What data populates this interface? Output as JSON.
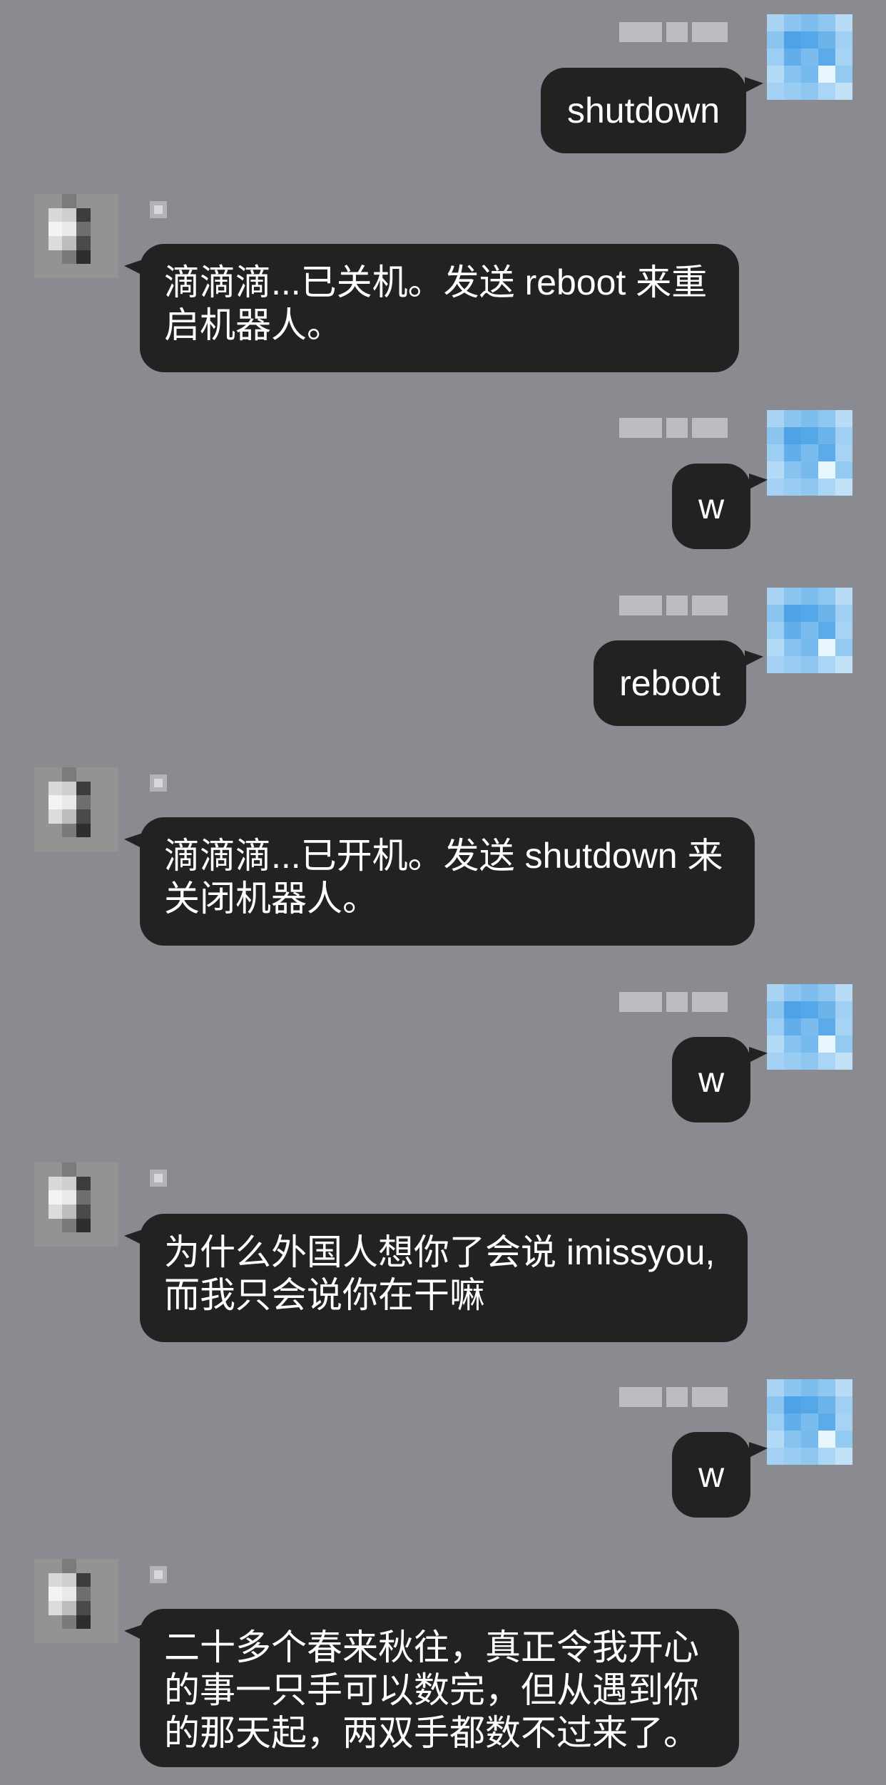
{
  "colors": {
    "background": "#8a8b90",
    "bubble": "#222222",
    "text": "#ffffff"
  },
  "messages": [
    {
      "from": "me",
      "text": "shutdown"
    },
    {
      "from": "bot",
      "text": "滴滴滴...已关机。发送 reboot 来重\n启机器人。"
    },
    {
      "from": "me",
      "text": "w"
    },
    {
      "from": "me",
      "text": "reboot"
    },
    {
      "from": "bot",
      "text": "滴滴滴...已开机。发送 shutdown 来\n关闭机器人。"
    },
    {
      "from": "me",
      "text": "w"
    },
    {
      "from": "bot",
      "text": "为什么外国人想你了会说 imissyou,\n而我只会说你在干嘛"
    },
    {
      "from": "me",
      "text": "w"
    },
    {
      "from": "bot",
      "text": "二十多个春来秋往，真正令我开心\n的事一只手可以数完，但从遇到你\n的那天起，两双手都数不过来了。"
    }
  ]
}
